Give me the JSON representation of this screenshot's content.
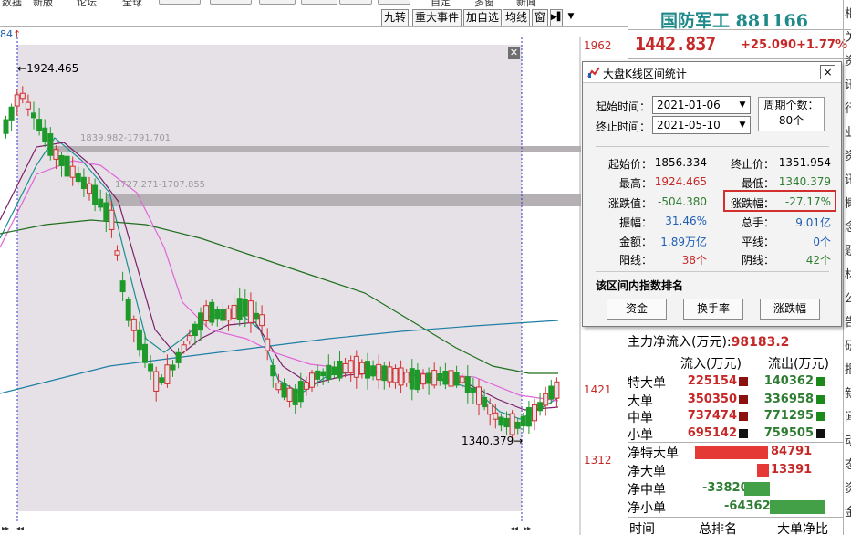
{
  "top_menu": [
    "数据",
    "新版",
    "论坛",
    "全球",
    "自定",
    "多窗",
    "新闻"
  ],
  "toolbar": {
    "tabs": [
      "九转",
      "重大事件",
      "加自选",
      "均线",
      "窗"
    ],
    "dropdown_icon": "triangle-down"
  },
  "chart": {
    "top_left_label": "84",
    "y_labels": {
      "top": "1962",
      "mid": "1421",
      "bottom": "1312"
    },
    "annotations": {
      "high": "1924.465",
      "low": "1340.379",
      "band1": "1839.982-1791.701",
      "band2": "1727.271-1707.855"
    },
    "colors": {
      "up": "#d32f2f",
      "down": "#1f9a2a",
      "background_selected": "#e6e1e7",
      "ma5": "#1a8f8f",
      "ma10": "#7a1f6a",
      "ma20": "#e066d8",
      "ma60": "#1f6f1f",
      "ma120": "#1f7fa6"
    }
  },
  "stock": {
    "name": "国防军工",
    "code": "881166",
    "price": "1442.837",
    "change": "+25.090",
    "change_pct": "+1.77%"
  },
  "dialog": {
    "title": "大盘K线区间统计",
    "close": "×",
    "start_time_label": "起始时间：",
    "start_time": "2021-01-06",
    "end_time_label": "终止时间：",
    "end_time": "2021-05-10",
    "cycle_label": "周期个数：",
    "cycle_count": "80个",
    "stats": {
      "start_price_label": "起始价：",
      "start_price": "1856.334",
      "end_price_label": "终止价：",
      "end_price": "1351.954",
      "high_label": "最高：",
      "high": "1924.465",
      "low_label": "最低：",
      "low": "1340.379",
      "change_label": "涨跌值：",
      "change": "-504.380",
      "change_pct_label": "涨跌幅：",
      "change_pct": "-27.17%",
      "amplitude_label": "振幅：",
      "amplitude": "31.46%",
      "volume_label": "总手：",
      "volume": "9.01亿",
      "amount_label": "金额：",
      "amount": "1.89万亿",
      "flat_label": "平线：",
      "flat": "0个",
      "up_label": "阳线：",
      "up": "38个",
      "down_label": "阴线：",
      "down": "42个"
    },
    "ranking_title": "该区间内指数排名",
    "buttons": [
      "资金",
      "换手率",
      "涨跌幅"
    ]
  },
  "fund_flow": {
    "main_net_label": "主力净流入(万元):",
    "main_net_value": "98183.2",
    "col_in": "流入(万元)",
    "col_out": "流出(万元)",
    "rows": [
      {
        "label": "特大单",
        "in": "225154",
        "out": "140362"
      },
      {
        "label": "大单",
        "in": "350350",
        "out": "336958"
      },
      {
        "label": "中单",
        "in": "737474",
        "out": "771295"
      },
      {
        "label": "小单",
        "in": "695142",
        "out": "759505"
      }
    ],
    "net_rows": [
      {
        "label": "净特大单",
        "value": "84791",
        "sign": 1
      },
      {
        "label": "净大单",
        "value": "13391",
        "sign": 1
      },
      {
        "label": "净中单",
        "value": "-33820",
        "sign": -1
      },
      {
        "label": "净小单",
        "value": "-64362",
        "sign": -1
      }
    ],
    "footer": [
      "时间",
      "总排名",
      "大单净比"
    ]
  },
  "side_chars": [
    "相",
    "关",
    "资",
    "讯",
    "行",
    "业",
    "资",
    "讯",
    "概",
    "念",
    "题",
    "材",
    "公",
    "告",
    "研",
    "报",
    "新",
    "闻",
    "动",
    "态",
    "资",
    "金"
  ]
}
